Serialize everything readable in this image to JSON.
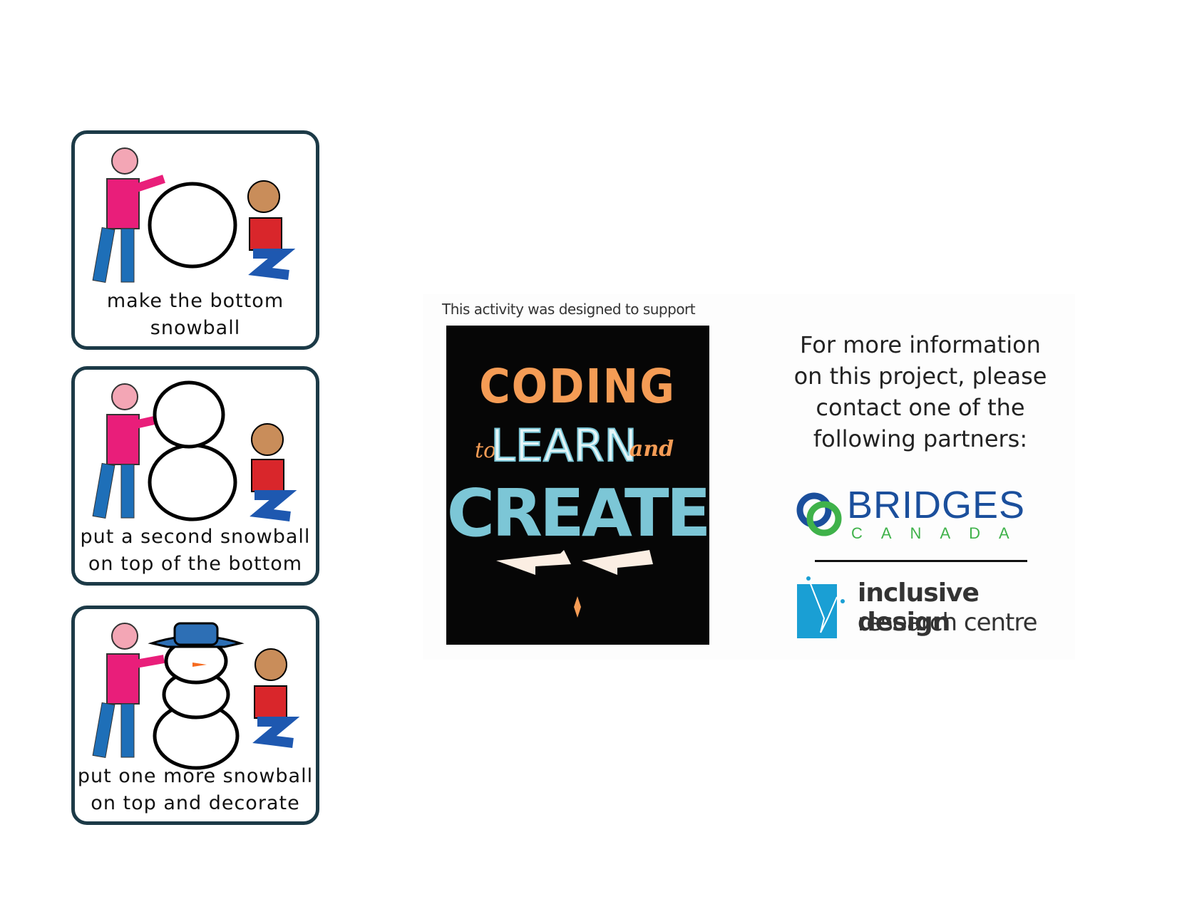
{
  "cards": [
    {
      "caption_line1": "make the bottom",
      "caption_line2": "snowball"
    },
    {
      "caption_line1": "put a second snowball",
      "caption_line2": "on top of the bottom"
    },
    {
      "caption_line1": "put one more snowball",
      "caption_line2": "on top and decorate"
    }
  ],
  "support_caption": "This activity was designed to support",
  "poster": {
    "line1": "CODING",
    "line2_left": "to",
    "line2_mid": "LEARN",
    "line2_right": "and",
    "line3": "CREATE"
  },
  "info": {
    "line1": "For more information",
    "line2": "on this project, please",
    "line3": "contact one of the",
    "line4": "following partners:"
  },
  "partners": {
    "bridges": {
      "name": "BRIDGES",
      "sub": "CANADA"
    },
    "idrc": {
      "line1": "inclusive design",
      "line2": "research centre"
    }
  },
  "colors": {
    "card_border": "#1c3a47",
    "poster_orange": "#f59c55",
    "poster_blue": "#7cc6d6",
    "bridges_blue": "#1b4f9c",
    "bridges_green": "#3fb24a",
    "idrc_blue": "#1a9fd4"
  }
}
